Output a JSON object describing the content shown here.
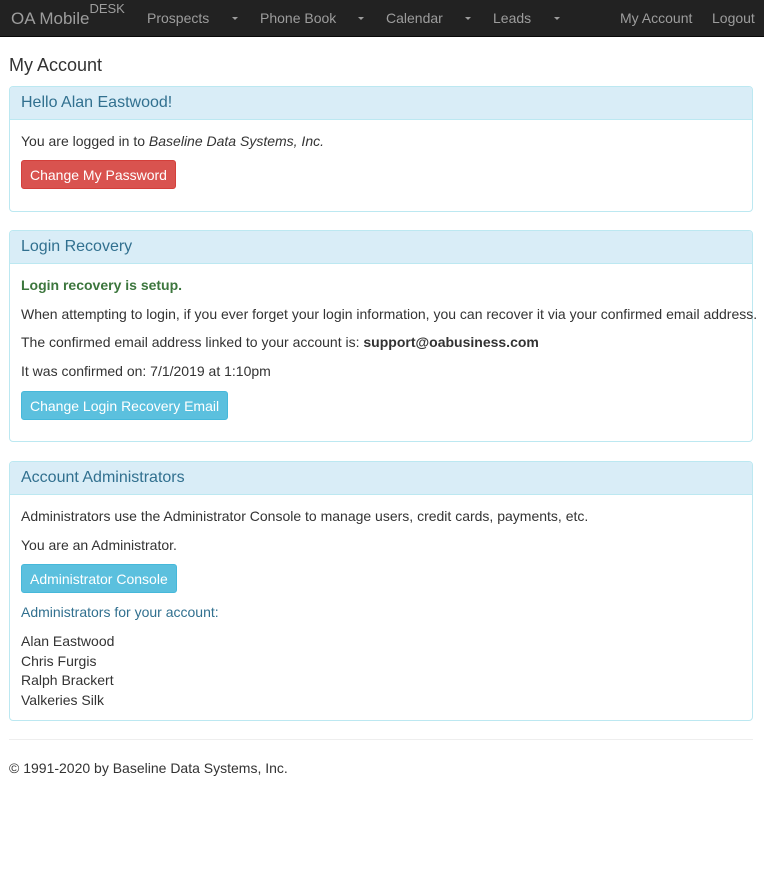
{
  "navbar": {
    "brand": "OA Mobile",
    "brand_sup": "DESK",
    "menus": [
      {
        "label": "Prospects",
        "icon": "caret-down-icon"
      },
      {
        "label": "Phone Book",
        "icon": "caret-down-icon"
      },
      {
        "label": "Calendar",
        "icon": "caret-down-icon"
      },
      {
        "label": "Leads",
        "icon": "caret-down-icon"
      }
    ],
    "right_links": [
      {
        "label": "My Account"
      },
      {
        "label": "Logout"
      }
    ]
  },
  "page": {
    "title": "My Account"
  },
  "panels": {
    "hello": {
      "heading": "Hello Alan Eastwood!",
      "logged_in_prefix": "You are logged in to ",
      "company": "Baseline Data Systems, Inc.",
      "button": "Change My Password"
    },
    "recovery": {
      "heading": "Login Recovery",
      "status": "Login recovery is setup.",
      "description": "When attempting to login, if you ever forget your login information, you can recover it via your confirmed email address.",
      "email_prefix": "The confirmed email address linked to your account is: ",
      "email": "support@oabusiness.com",
      "confirmed_on": "It was confirmed on: 7/1/2019 at 1:10pm",
      "button": "Change Login Recovery Email"
    },
    "admins": {
      "heading": "Account Administrators",
      "description": "Administrators use the Administrator Console to manage users, credit cards, payments, etc.",
      "role_note": "You are an Administrator.",
      "button": "Administrator Console",
      "list_label": "Administrators for your account:",
      "list": [
        "Alan Eastwood",
        "Chris Furgis",
        "Ralph Brackert",
        "Valkeries Silk"
      ]
    }
  },
  "footer": {
    "copyright": "© 1991-2020 by Baseline Data Systems, Inc."
  },
  "colors": {
    "navbar_bg": "#222222",
    "nav_text": "#9d9d9d",
    "panel_heading_bg": "#d9edf7",
    "panel_border": "#bce8f1",
    "panel_heading_text": "#31708f",
    "danger": "#d9534f",
    "info": "#5bc0de",
    "success_text": "#3c763d"
  }
}
